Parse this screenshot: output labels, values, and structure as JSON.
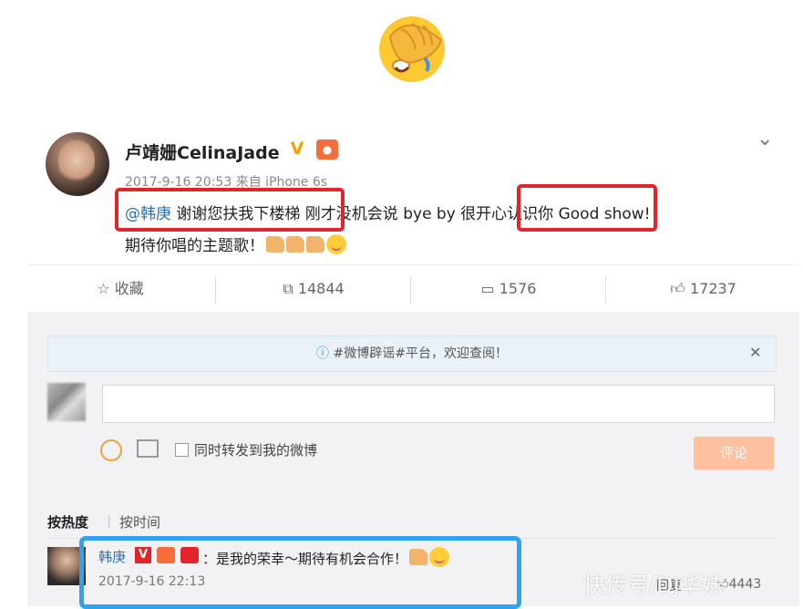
{
  "post": {
    "author": "卢靖姗CelinaJade",
    "meta": "2017-9-16 20:53 来自 iPhone 6s",
    "line1": {
      "mention": "@韩庚",
      "part1": " 谢谢您扶我下楼梯",
      "part2": " 刚才没机会说 bye by",
      "part3": " 很开心认识你",
      "part4": " Good show!"
    },
    "line2": "期待你唱的主题歌！"
  },
  "actions": {
    "favorite_label": "收藏",
    "repost_count": "14844",
    "comment_count": "1576",
    "like_count": "17237"
  },
  "comment_box": {
    "notice": "#微博辟谣#平台，欢迎查阅！",
    "repost_checkbox_label": "同时转发到我的微博",
    "submit_label": "评论"
  },
  "sort": {
    "hot_label": "按热度",
    "time_label": "按时间"
  },
  "reply": {
    "author": "韩庚",
    "text": "：是我的荣幸～期待有机会合作！",
    "time": "2017-9-16 22:13",
    "reply_label": "回复",
    "likes": "4443"
  },
  "watermark": "快传号/DJ华妹",
  "colors": {
    "highlight_red": "#e3242b",
    "highlight_blue": "#2ea3f2",
    "link_blue": "#2a6fb5",
    "submit_button": "#ffc09f"
  },
  "icons": [
    "face-palm-emoji",
    "verified-v-icon",
    "medal-icon",
    "chevron-down-icon",
    "star-icon",
    "repost-icon",
    "comment-icon",
    "like-icon",
    "info-icon",
    "close-icon",
    "smile-icon",
    "image-icon"
  ]
}
